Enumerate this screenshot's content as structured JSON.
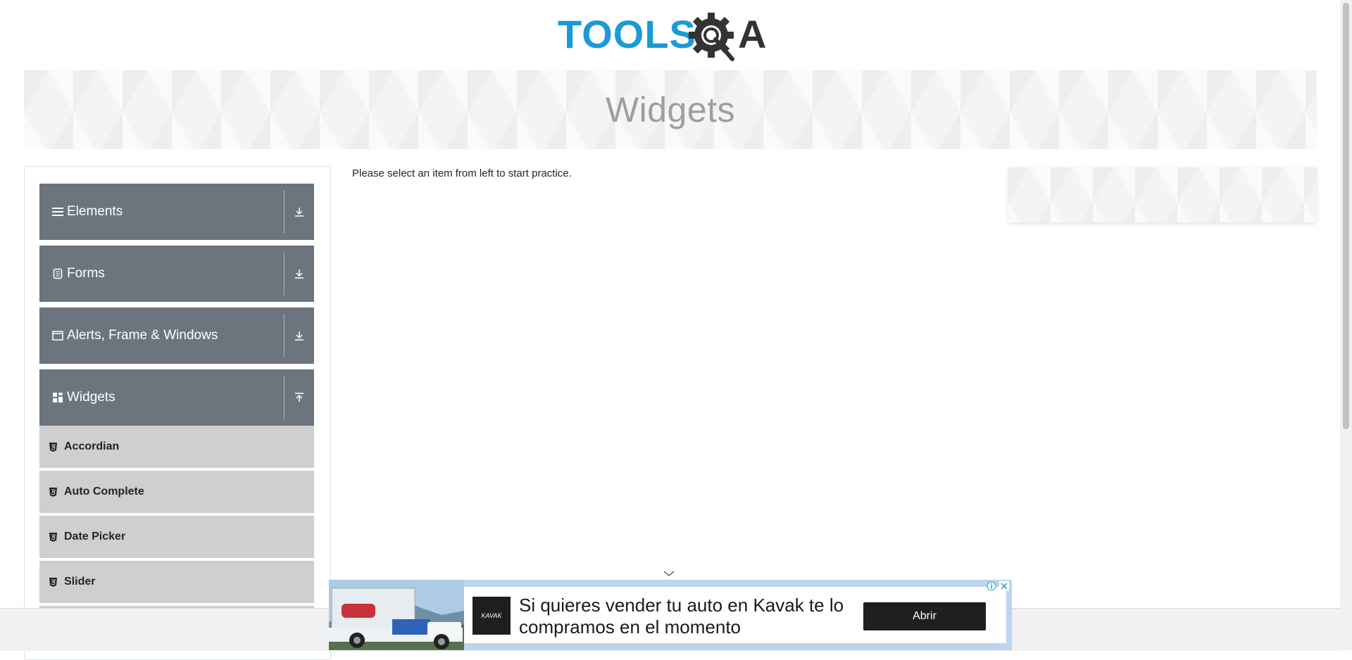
{
  "logo": {
    "text": "TOOLSQA",
    "brand_color": "#1a9ad6",
    "dark_color": "#333333"
  },
  "banner": {
    "title": "Widgets"
  },
  "sidebar": {
    "groups": [
      {
        "label": "Elements",
        "icon": "hamburger-icon",
        "expanded": false
      },
      {
        "label": "Forms",
        "icon": "document-icon",
        "expanded": false
      },
      {
        "label": "Alerts, Frame & Windows",
        "icon": "window-icon",
        "expanded": false
      },
      {
        "label": "Widgets",
        "icon": "grid-icon",
        "expanded": true
      }
    ],
    "widget_items": [
      {
        "label": "Accordian"
      },
      {
        "label": "Auto Complete"
      },
      {
        "label": "Date Picker"
      },
      {
        "label": "Slider"
      }
    ]
  },
  "main": {
    "message": "Please select an item from left to start practice."
  },
  "ad": {
    "brand": "KAVAK",
    "text": "Si quieres vender tu auto en Kavak te lo compramos en el momento",
    "button_label": "Abrir"
  },
  "colors": {
    "sidebar_group": "#6c757d",
    "sidebar_item": "#cfcfcf",
    "banner_title": "#9e9e9e"
  }
}
